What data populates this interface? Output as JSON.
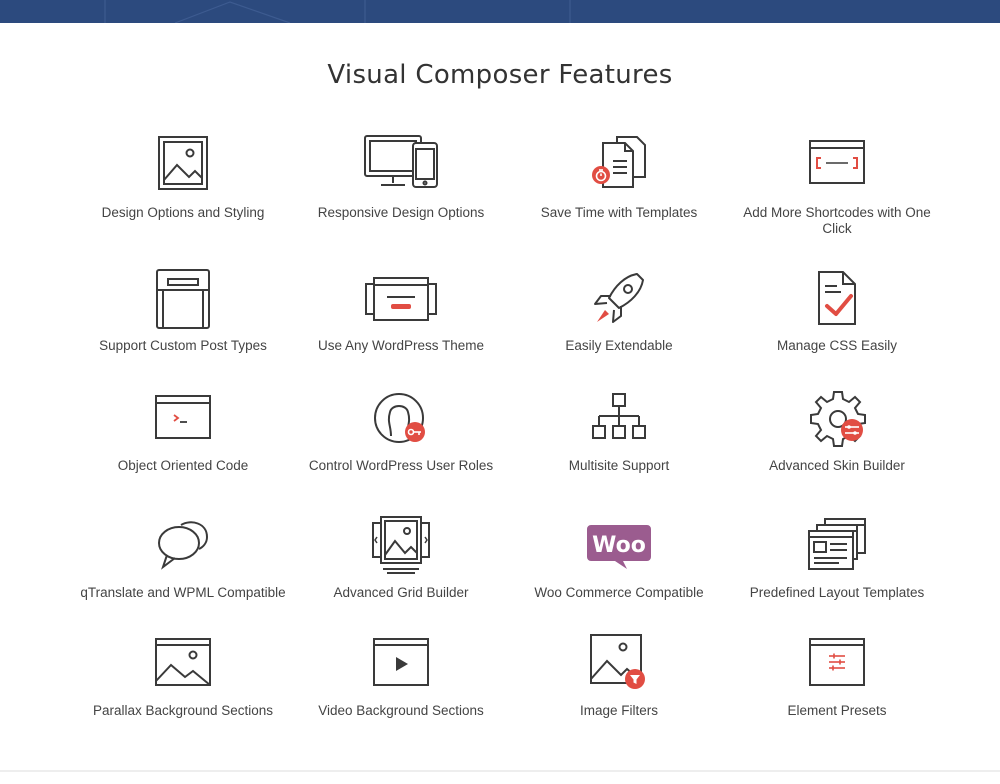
{
  "page": {
    "title": "Visual Composer Features",
    "accent_color": "#e14d43",
    "icon_stroke_color": "#3a3a3a",
    "banner_color": "#2c4a7e",
    "woo_badge_color": "#9b5c8f"
  },
  "features": [
    {
      "label": "Design Options and Styling",
      "icon": "image-frame-icon"
    },
    {
      "label": "Responsive Design Options",
      "icon": "devices-icon"
    },
    {
      "label": "Save Time with Templates",
      "icon": "templates-clock-icon"
    },
    {
      "label": "Add More Shortcodes with One Click",
      "icon": "shortcode-window-icon"
    },
    {
      "label": "Support Custom Post Types",
      "icon": "custom-post-types-icon"
    },
    {
      "label": "Use Any WordPress Theme",
      "icon": "themes-icon"
    },
    {
      "label": "Easily Extendable",
      "icon": "rocket-icon"
    },
    {
      "label": "Manage CSS Easily",
      "icon": "css-document-check-icon"
    },
    {
      "label": "Object Oriented Code",
      "icon": "terminal-window-icon"
    },
    {
      "label": "Control WordPress User Roles",
      "icon": "user-role-key-icon"
    },
    {
      "label": "Multisite Support",
      "icon": "sitemap-icon"
    },
    {
      "label": "Advanced Skin Builder",
      "icon": "gear-settings-icon"
    },
    {
      "label": "qTranslate and WPML Compatible",
      "icon": "speech-bubbles-icon"
    },
    {
      "label": "Advanced Grid Builder",
      "icon": "grid-gallery-icon"
    },
    {
      "label": "Woo Commerce Compatible",
      "icon": "woo-logo-icon",
      "badge_text": "Woo"
    },
    {
      "label": "Predefined Layout Templates",
      "icon": "layout-templates-icon"
    },
    {
      "label": "Parallax Background Sections",
      "icon": "landscape-image-icon"
    },
    {
      "label": "Video Background Sections",
      "icon": "video-window-icon"
    },
    {
      "label": "Image Filters",
      "icon": "image-filter-icon"
    },
    {
      "label": "Element Presets",
      "icon": "sliders-window-icon"
    }
  ]
}
